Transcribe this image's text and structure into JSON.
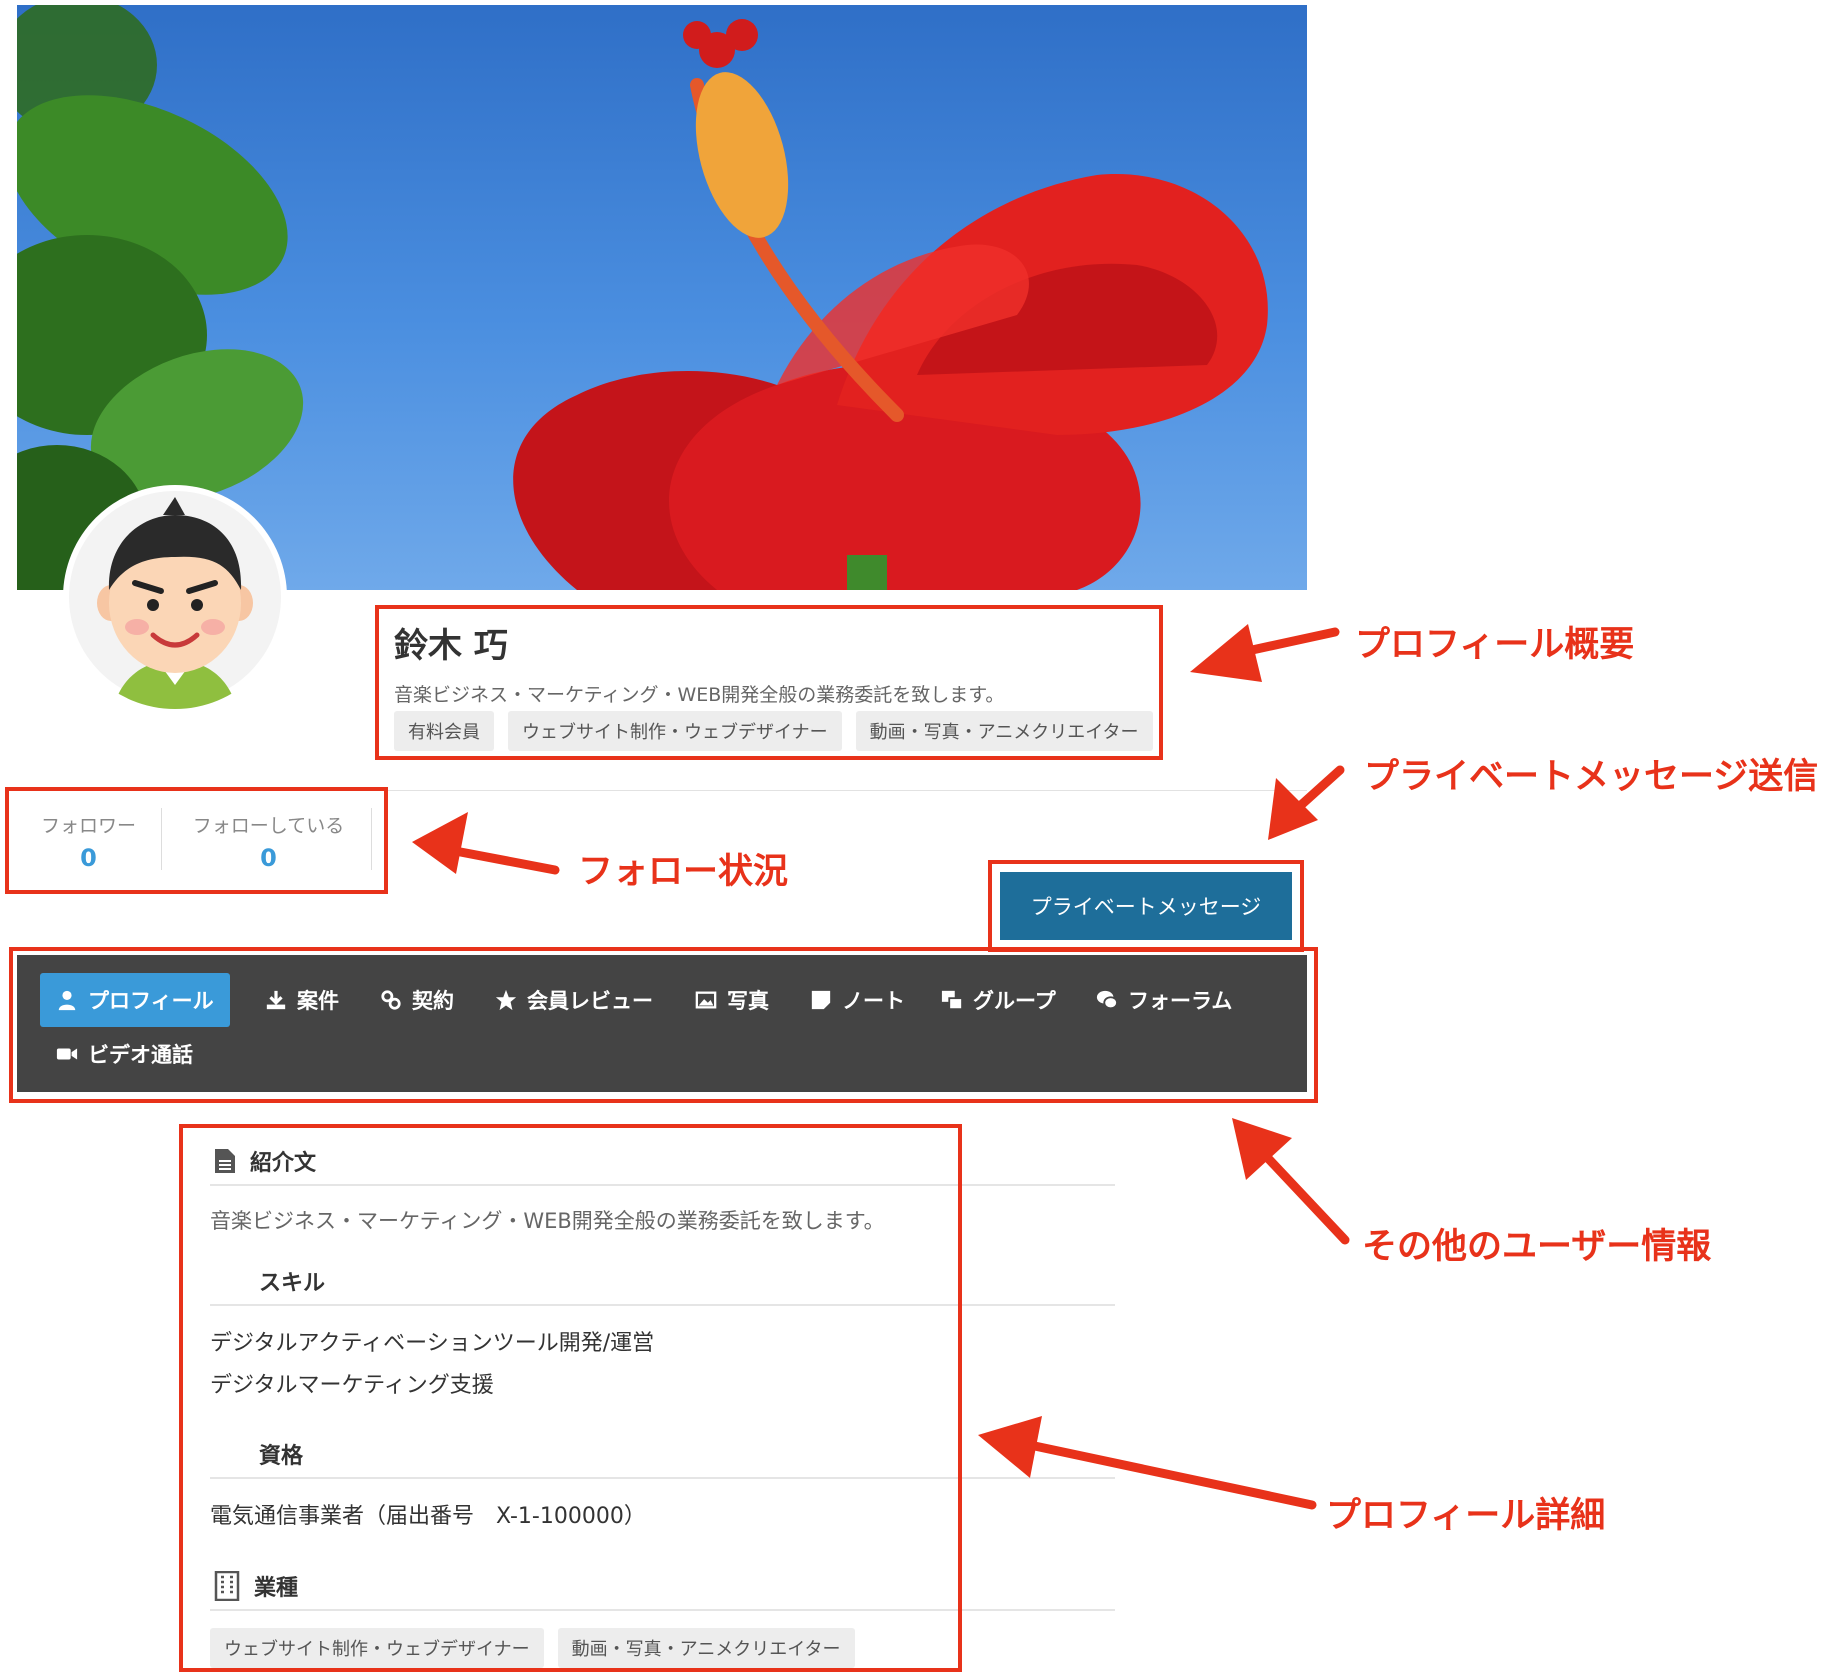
{
  "profile": {
    "name": "鈴木 巧",
    "tagline": "音楽ビジネス・マーケティング・WEB開発全般の業務委託を致します。",
    "tags": [
      "有料会員",
      "ウェブサイト制作・ウェブデザイナー",
      "動画・写真・アニメクリエイター"
    ]
  },
  "follow": {
    "followers_label": "フォロワー",
    "followers_count": "0",
    "following_label": "フォローしている",
    "following_count": "0"
  },
  "pm_button_label": "プライベートメッセージ",
  "nav": {
    "items": [
      {
        "label": "プロフィール",
        "icon": "user-icon",
        "active": true
      },
      {
        "label": "案件",
        "icon": "download-icon"
      },
      {
        "label": "契約",
        "icon": "link-icon"
      },
      {
        "label": "会員レビュー",
        "icon": "star-icon"
      },
      {
        "label": "写真",
        "icon": "image-icon"
      },
      {
        "label": "ノート",
        "icon": "note-icon"
      },
      {
        "label": "グループ",
        "icon": "group-icon"
      },
      {
        "label": "フォーラム",
        "icon": "comments-icon"
      },
      {
        "label": "ビデオ通話",
        "icon": "video-icon"
      }
    ]
  },
  "details": {
    "intro_title": "紹介文",
    "intro_text": "音楽ビジネス・マーケティング・WEB開発全般の業務委託を致します。",
    "skills_title": "スキル",
    "skills": [
      "デジタルアクティベーションツール開発/運営",
      "デジタルマーケティング支援"
    ],
    "qual_title": "資格",
    "qual_text": "電気通信事業者（届出番号　X-1-100000）",
    "industry_title": "業種",
    "industry_tags": [
      "ウェブサイト制作・ウェブデザイナー",
      "動画・写真・アニメクリエイター"
    ]
  },
  "annotations": {
    "summary": "プロフィール概要",
    "pm": "プライベートメッセージ送信",
    "follow": "フォロー状況",
    "other": "その他のユーザー情報",
    "detail": "プロフィール詳細"
  },
  "colors": {
    "annotation": "#e8321a",
    "nav_bg": "#444444",
    "accent": "#3a9ad9",
    "pm_button": "#1e6e9a"
  }
}
